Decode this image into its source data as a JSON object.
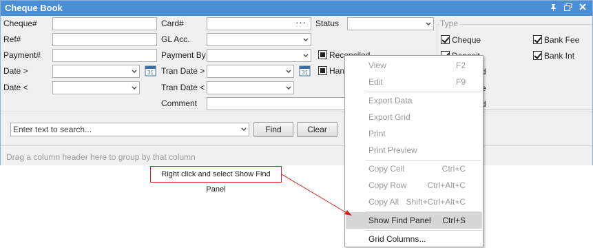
{
  "window": {
    "title": "Cheque Book"
  },
  "filters": {
    "cheque_label": "Cheque#",
    "ref_label": "Ref#",
    "payment_label": "Payment#",
    "date_from_label": "Date >",
    "date_to_label": "Date <",
    "card_label": "Card#",
    "card_ellipsis": "···",
    "gl_label": "GL Acc.",
    "payment_by_label": "Payment By",
    "tran_date_from_label": "Tran Date >",
    "tran_date_to_label": "Tran Date <",
    "comment_label": "Comment",
    "status_label": "Status",
    "reconciled_label": "Reconciled",
    "hand_label": "Hand",
    "calendar_day": "31"
  },
  "type_panel": {
    "legend": "Type",
    "items": [
      {
        "label": "Cheque",
        "checked": true
      },
      {
        "label": "Deposit",
        "checked": true
      },
      {
        "label": "Bank Fee",
        "checked": true
      },
      {
        "label": "Bank Int",
        "checked": true
      }
    ],
    "partial_labels": [
      "d",
      "e",
      "d"
    ]
  },
  "search": {
    "placeholder": "Enter text to search...",
    "find_label": "Find",
    "clear_label": "Clear"
  },
  "grid": {
    "group_hint": "Drag a column header here to group by that column"
  },
  "context_menu": {
    "items": [
      {
        "label": "View",
        "shortcut": "F2",
        "enabled": false
      },
      {
        "label": "Edit",
        "shortcut": "F9",
        "enabled": false
      },
      {
        "label": "Export Data",
        "shortcut": "",
        "enabled": false
      },
      {
        "label": "Export Grid",
        "shortcut": "",
        "enabled": false
      },
      {
        "label": "Print",
        "shortcut": "",
        "enabled": false
      },
      {
        "label": "Print Preview",
        "shortcut": "",
        "enabled": false
      },
      {
        "label": "Copy Cell",
        "shortcut": "Ctrl+C",
        "enabled": false
      },
      {
        "label": "Copy Row",
        "shortcut": "Ctrl+Alt+C",
        "enabled": false
      },
      {
        "label": "Copy All",
        "shortcut": "Shift+Ctrl+Alt+C",
        "enabled": false
      },
      {
        "label": "Show Find Panel",
        "shortcut": "Ctrl+S",
        "enabled": true,
        "highlighted": true
      },
      {
        "label": "Grid Columns...",
        "shortcut": "",
        "enabled": true
      }
    ]
  },
  "annotation": {
    "callout": "Right click and select Show Find Panel"
  },
  "colors": {
    "title_bar": "#4a8fd6",
    "callout_border": "#d42020",
    "menu_highlight": "#d6d6d6"
  }
}
